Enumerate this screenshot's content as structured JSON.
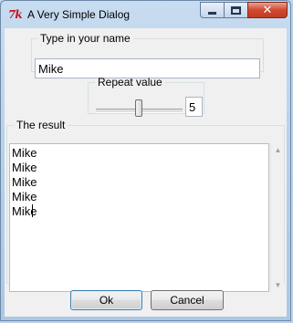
{
  "window": {
    "title": "A Very Simple Dialog",
    "app_icon_text": "7k",
    "minimize_glyph": "",
    "close_glyph": "✕"
  },
  "name_group": {
    "label": "Type in your name",
    "value": "Mike"
  },
  "repeat_group": {
    "label": "Repeat value",
    "value": "5",
    "slider_fraction": 0.5
  },
  "result_group": {
    "label": "The result",
    "lines": [
      "Mike",
      "Mike",
      "Mike",
      "Mike",
      "Mike"
    ]
  },
  "buttons": {
    "ok_label": "Ok",
    "cancel_label": "Cancel"
  }
}
